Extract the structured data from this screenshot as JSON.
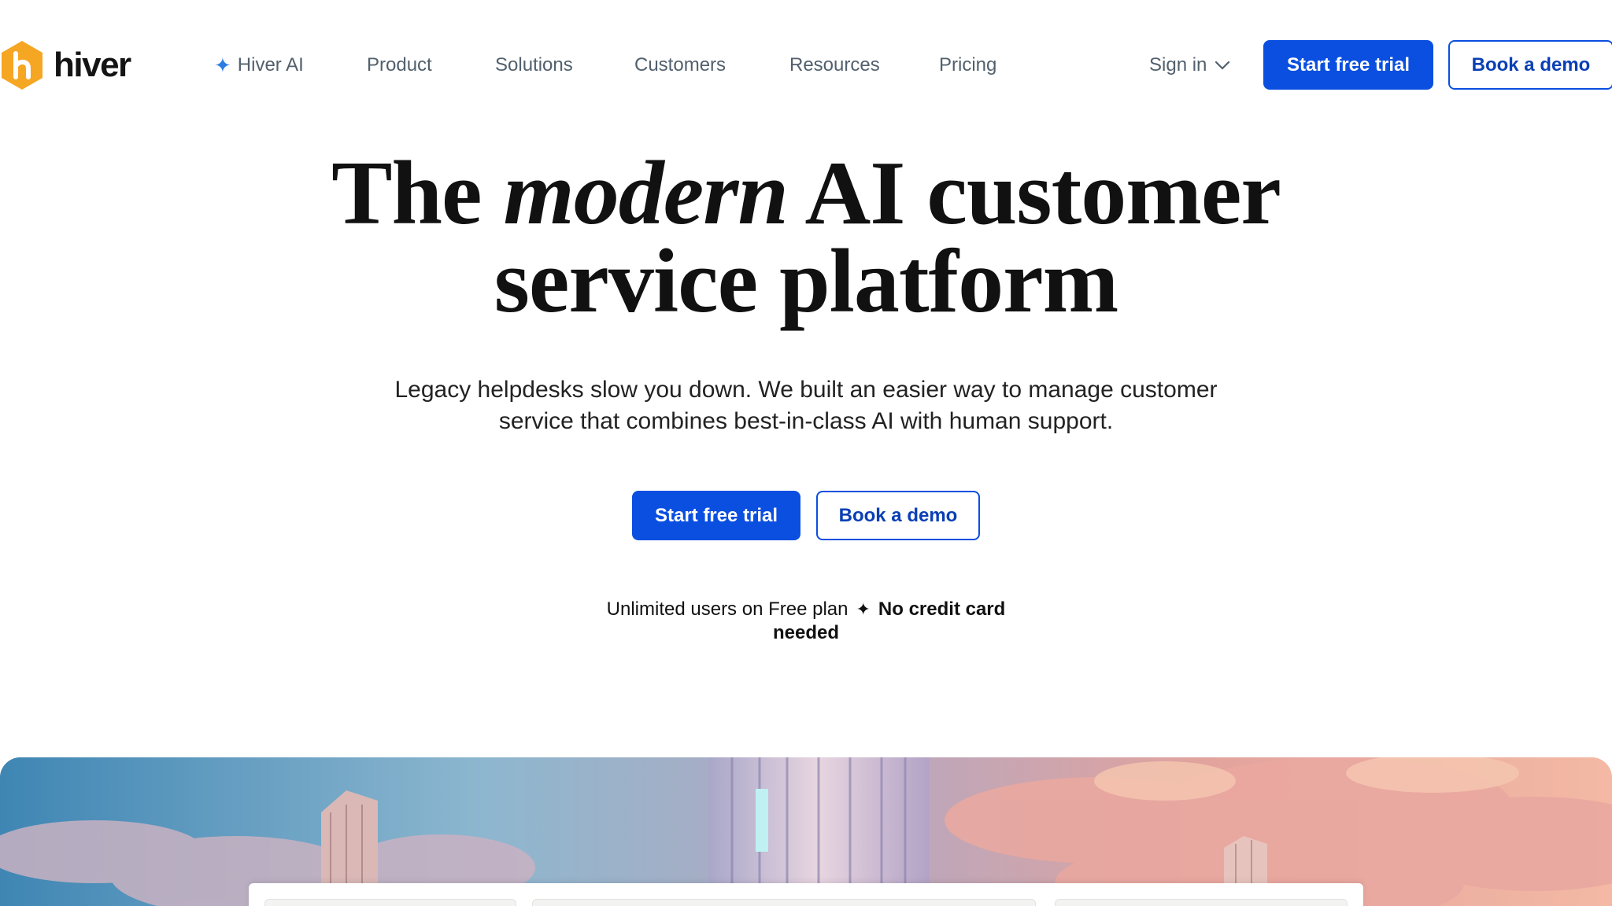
{
  "brand": {
    "name": "hiver",
    "color": "#F5A623"
  },
  "nav": {
    "items": [
      {
        "label": "Hiver AI",
        "icon": "sparkle-icon"
      },
      {
        "label": "Product"
      },
      {
        "label": "Solutions"
      },
      {
        "label": "Customers"
      },
      {
        "label": "Resources"
      },
      {
        "label": "Pricing"
      }
    ],
    "sign_in": "Sign in",
    "start_trial": "Start free trial",
    "book_demo": "Book a demo"
  },
  "hero": {
    "title_pre": "The ",
    "title_em": "modern",
    "title_post": " AI customer",
    "title_line2": "service platform",
    "subtitle_line1": "Legacy helpdesks slow you down. We built an easier way to manage customer",
    "subtitle_line2": "service that combines best-in-class AI with human support.",
    "cta_primary": "Start free trial",
    "cta_secondary": "Book a demo",
    "note_plain": "Unlimited users on Free plan",
    "note_separator": "✦",
    "note_bold_1": "No credit card",
    "note_bold_2": "needed"
  },
  "colors": {
    "primary": "#0A4FE0",
    "nav_text": "#52606D",
    "accent_sparkle": "#2A7DE1"
  }
}
